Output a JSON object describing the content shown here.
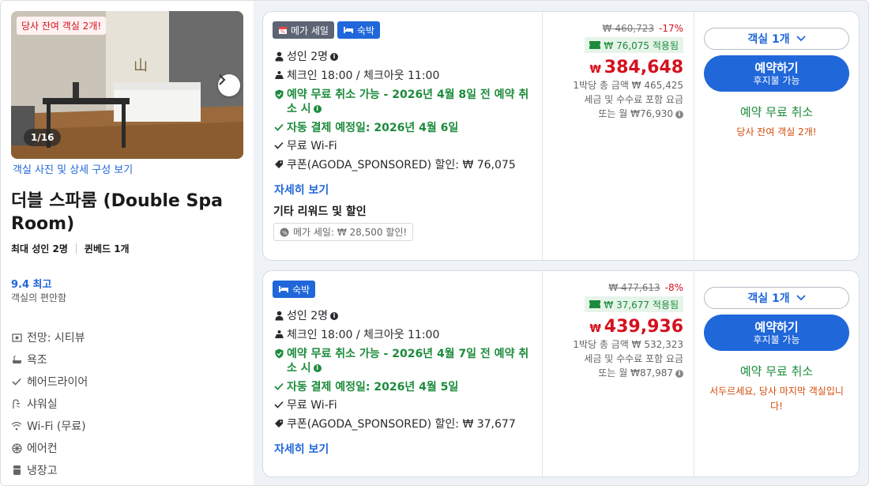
{
  "room": {
    "remaining_badge": "당사 잔여 객실 2개!",
    "photo_counter": "1/16",
    "photo_link": "객실 사진 및 상세 구성 보기",
    "name": "더블 스파룸 (Double Spa Room)",
    "max_guests": "최대 성인 2명",
    "bed": "퀸베드 1개",
    "score": "9.4 최고",
    "score_sub": "객실의 편안함",
    "amenities": [
      {
        "icon": "view-icon",
        "label": "전망: 시티뷰"
      },
      {
        "icon": "bathtub-icon",
        "label": "욕조"
      },
      {
        "icon": "check-icon",
        "label": "헤어드라이어"
      },
      {
        "icon": "shower-icon",
        "label": "샤워실"
      },
      {
        "icon": "wifi-icon",
        "label": "Wi-Fi (무료)"
      },
      {
        "icon": "aircon-icon",
        "label": "에어컨"
      },
      {
        "icon": "fridge-icon",
        "label": "냉장고"
      }
    ]
  },
  "offers": [
    {
      "tags": [
        {
          "icon": "calendar-icon",
          "label": "메가 세일"
        },
        {
          "icon": "bed-icon",
          "label": "숙박"
        }
      ],
      "guests": "성인 2명",
      "checkin": "체크인 18:00 / 체크아웃 11:00",
      "free_cancel": "예약 무료 취소 가능 - 2026년 4월 8일 전 예약 취소 시",
      "auto_pay": "자동 결제 예정일: 2026년 4월 6일",
      "wifi": "무료 Wi-Fi",
      "coupon_line": "쿠폰(AGODA_SPONSORED) 할인: ₩ 76,075",
      "more_link": "자세히 보기",
      "other_title": "기타 리워드 및 할인",
      "promo_chip": "메가 세일: ₩ 28,500 할인!",
      "orig_price": "₩ 460,723",
      "discount": "-17%",
      "coupon_applied": "₩ 76,075 적용됨",
      "currency": "₩",
      "final_price": "384,648",
      "sub1": "1박당 총 금액 ₩ 465,425",
      "sub2": "세금 및 수수료 포함 요금",
      "sub3": "또는 월 ₩76,930",
      "rooms_select": "객실 1개",
      "book_main": "예약하기",
      "book_sub": "후지불 가능",
      "free_cancel_short": "예약 무료 취소",
      "warning": "당사 잔여 객실 2개!"
    },
    {
      "tags": [
        {
          "icon": "bed-icon",
          "label": "숙박"
        }
      ],
      "guests": "성인 2명",
      "checkin": "체크인 18:00 / 체크아웃 11:00",
      "free_cancel": "예약 무료 취소 가능 - 2026년 4월 7일 전 예약 취소 시",
      "auto_pay": "자동 결제 예정일: 2026년 4월 5일",
      "wifi": "무료 Wi-Fi",
      "coupon_line": "쿠폰(AGODA_SPONSORED) 할인: ₩ 37,677",
      "more_link": "자세히 보기",
      "orig_price": "₩ 477,613",
      "discount": "-8%",
      "coupon_applied": "₩ 37,677 적용됨",
      "currency": "₩",
      "final_price": "439,936",
      "sub1": "1박당 총 금액 ₩ 532,323",
      "sub2": "세금 및 수수료 포함 요금",
      "sub3": "또는 월 ₩87,987",
      "rooms_select": "객실 1개",
      "book_main": "예약하기",
      "book_sub": "후지불 가능",
      "free_cancel_short": "예약 무료 취소",
      "warning": "서두르세요, 당사 마지막 객실입니다!"
    }
  ],
  "colors": {
    "accent": "#2067da",
    "price_red": "#d4111e",
    "green": "#1c8b3b",
    "warn_orange": "#d34b0b"
  }
}
